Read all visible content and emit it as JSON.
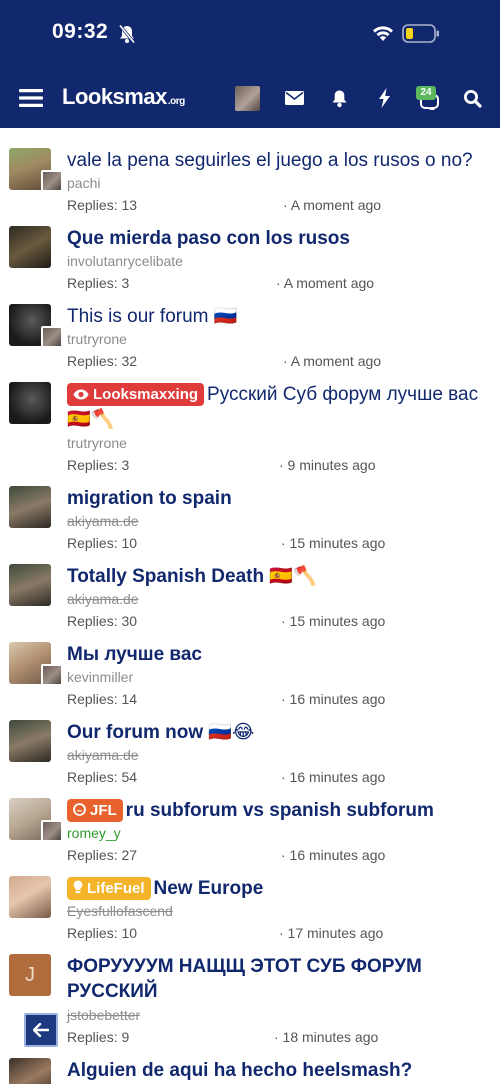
{
  "status_bar": {
    "time": "09:32"
  },
  "nav": {
    "logo_main": "Looksmax",
    "logo_tld": ".org",
    "conversations_badge": "24"
  },
  "threads": [
    {
      "title": "vale la pena seguirles el juego a los rusos o no?",
      "prefix": "",
      "bold": false,
      "author": "pachi",
      "replies": "Replies: 13",
      "time": "· A moment ago"
    },
    {
      "title": "Que mierda paso con los rusos",
      "prefix": "",
      "bold": true,
      "author": "involutanrycelibate",
      "replies": "Replies: 3",
      "time": "· A moment ago"
    },
    {
      "title": "This is our forum 🇷🇺",
      "prefix": "",
      "bold": false,
      "author": "trutryrone",
      "replies": "Replies: 32",
      "time": "· A moment ago"
    },
    {
      "title": "Русский Суб форум лучше вас 🇪🇸🪓",
      "prefix": "Looksmaxxing",
      "bold": false,
      "author": "trutryrone",
      "replies": "Replies: 3",
      "time": "· 9 minutes ago"
    },
    {
      "title": "migration to spain",
      "prefix": "",
      "bold": true,
      "author": "akiyama.de",
      "replies": "Replies: 10",
      "time": "· 15 minutes ago"
    },
    {
      "title": "Totally Spanish Death 🇪🇸🪓",
      "prefix": "",
      "bold": true,
      "author": "akiyama.de",
      "replies": "Replies: 30",
      "time": "· 15 minutes ago"
    },
    {
      "title": "Мы лучше вас",
      "prefix": "",
      "bold": true,
      "author": "kevinmiller",
      "replies": "Replies: 14",
      "time": "· 16 minutes ago"
    },
    {
      "title": "Our forum now 🇷🇺😂",
      "prefix": "",
      "bold": true,
      "author": "akiyama.de",
      "replies": "Replies: 54",
      "time": "· 16 minutes ago"
    },
    {
      "title": "ru subforum vs spanish subforum",
      "prefix": "JFL",
      "bold": true,
      "author": "romey_y",
      "replies": "Replies: 27",
      "time": "· 16 minutes ago"
    },
    {
      "title": "New Europe",
      "prefix": "LifeFuel",
      "bold": true,
      "author": "Eyesfullofascend",
      "replies": "Replies: 10",
      "time": "· 17 minutes ago"
    },
    {
      "title": "ФОРУУУУМ НАЩЩ ЭТОТ СУБ ФОРУМ РУССКИЙ",
      "prefix": "",
      "bold": true,
      "author": "jstobebetter",
      "avatar_letter": "J",
      "replies": "Replies: 9",
      "time": "· 18 minutes ago"
    },
    {
      "title": "Alguien de aqui ha hecho heelsmash?",
      "prefix": "",
      "bold": true,
      "author": "",
      "replies": "",
      "time": ""
    }
  ]
}
